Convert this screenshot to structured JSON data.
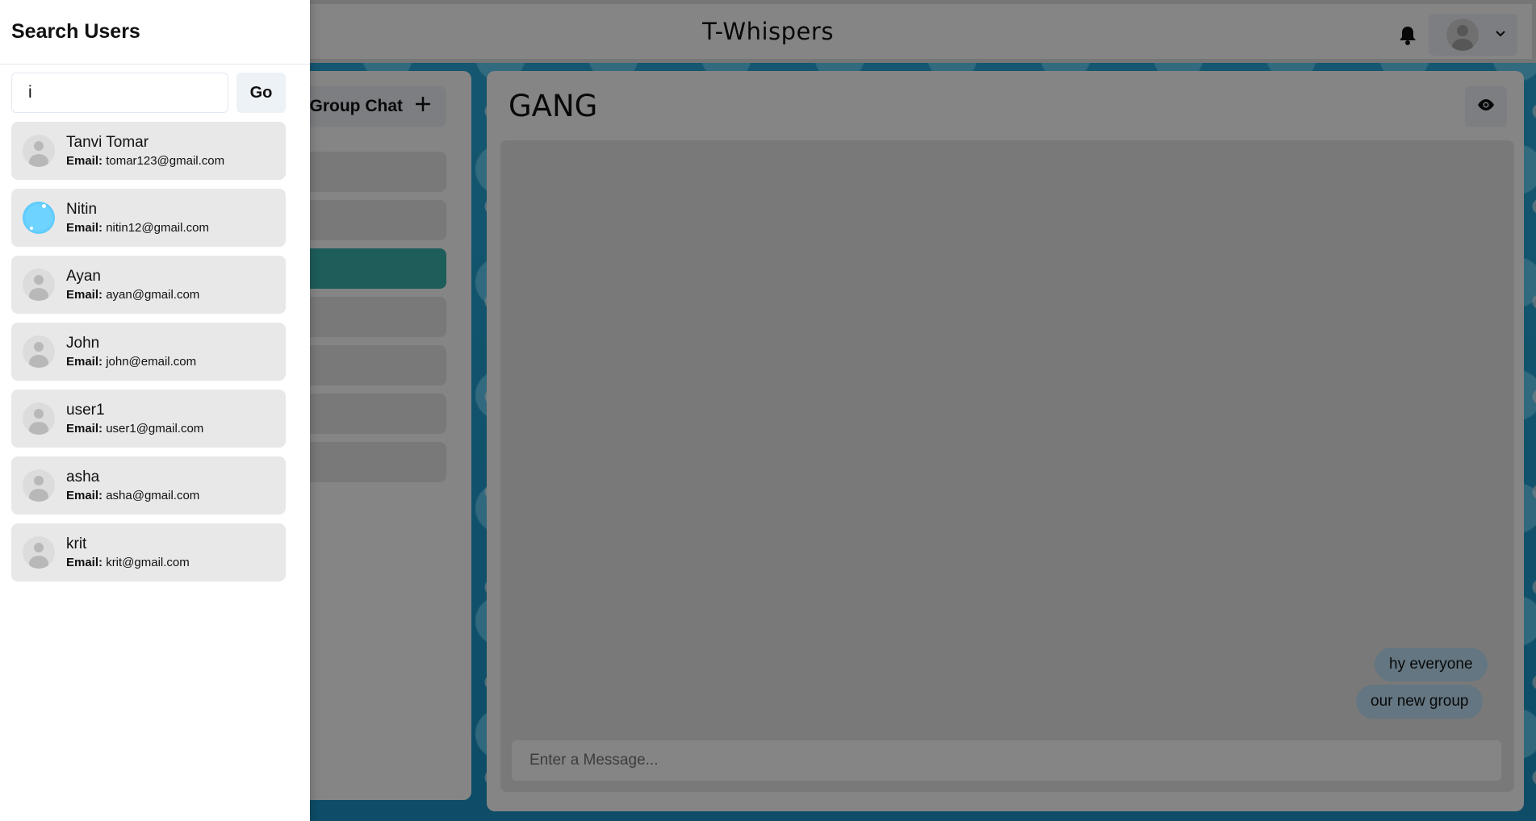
{
  "app": {
    "title": "T-Whispers"
  },
  "header": {
    "notification_icon": "bell-icon",
    "profile_icon": "avatar-icon",
    "menu_icon": "chevron-down-icon"
  },
  "chats": {
    "new_group_label": "Group Chat",
    "new_group_icon": "+",
    "items": [
      {
        "active": false
      },
      {
        "active": false
      },
      {
        "active": true
      },
      {
        "active": false
      },
      {
        "active": false
      },
      {
        "active": false
      },
      {
        "active": false
      }
    ]
  },
  "chat": {
    "title": "GANG",
    "messages": [
      "hy everyone",
      "our new group"
    ],
    "input_placeholder": "Enter a Message..."
  },
  "drawer": {
    "title": "Search Users",
    "search_value": "i",
    "go_label": "Go",
    "email_label": "Email:",
    "users": [
      {
        "name": "Tanvi Tomar",
        "email": "tomar123@gmail.com",
        "avatar": "default"
      },
      {
        "name": "Nitin",
        "email": "nitin12@gmail.com",
        "avatar": "photo"
      },
      {
        "name": "Ayan",
        "email": "ayan@gmail.com",
        "avatar": "default"
      },
      {
        "name": "John",
        "email": "john@email.com",
        "avatar": "default"
      },
      {
        "name": "user1",
        "email": "user1@gmail.com",
        "avatar": "default"
      },
      {
        "name": "asha",
        "email": "asha@gmail.com",
        "avatar": "default"
      },
      {
        "name": "krit",
        "email": "krit@gmail.com",
        "avatar": "default"
      }
    ]
  },
  "colors": {
    "accent": "#38b2ac",
    "bubble": "#bee3f8",
    "button_bg": "#edf2f7"
  }
}
